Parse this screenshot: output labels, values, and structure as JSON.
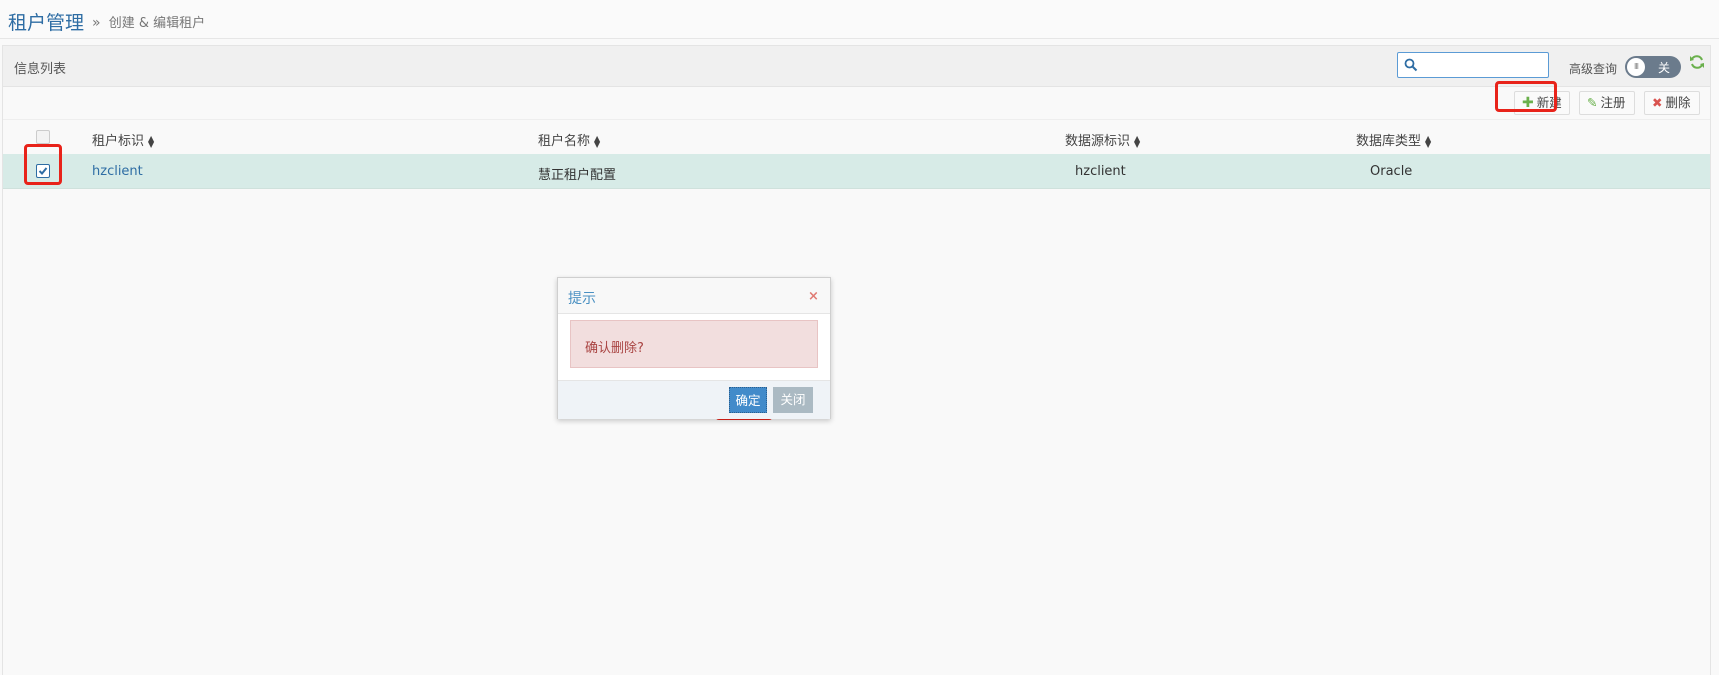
{
  "header": {
    "title": "租户管理",
    "breadcrumb_sep": "»",
    "breadcrumb": "创建 & 编辑租户"
  },
  "panel": {
    "title": "信息列表",
    "search": {
      "value": "",
      "placeholder": ""
    },
    "advanced_label": "高级查询",
    "toggle_state": "关",
    "toggle_knob": "III"
  },
  "toolbar": {
    "new_label": "新建",
    "register_label": "注册",
    "delete_label": "删除"
  },
  "table": {
    "columns": [
      "租户标识",
      "租户名称",
      "数据源标识",
      "数据库类型"
    ],
    "rows": [
      {
        "checked": true,
        "tenant_id": "hzclient",
        "tenant_name": "慧正租户配置",
        "datasource_id": "hzclient",
        "db_type": "Oracle"
      }
    ]
  },
  "modal": {
    "title": "提示",
    "close_glyph": "×",
    "message": "确认删除?",
    "ok_label": "确定",
    "close_label": "关闭"
  },
  "colors": {
    "accent": "#2e6da4",
    "selected_row": "#d7ebe7",
    "highlight": "#e8231a",
    "alert_bg": "#f2dede",
    "ok_button": "#428bca"
  },
  "icons": {
    "search": "search-icon",
    "refresh": "refresh-icon",
    "new": "plus-icon",
    "register": "pencil-icon",
    "delete": "x-icon",
    "sort": "sort-icon",
    "check": "check-icon",
    "close": "close-icon"
  }
}
